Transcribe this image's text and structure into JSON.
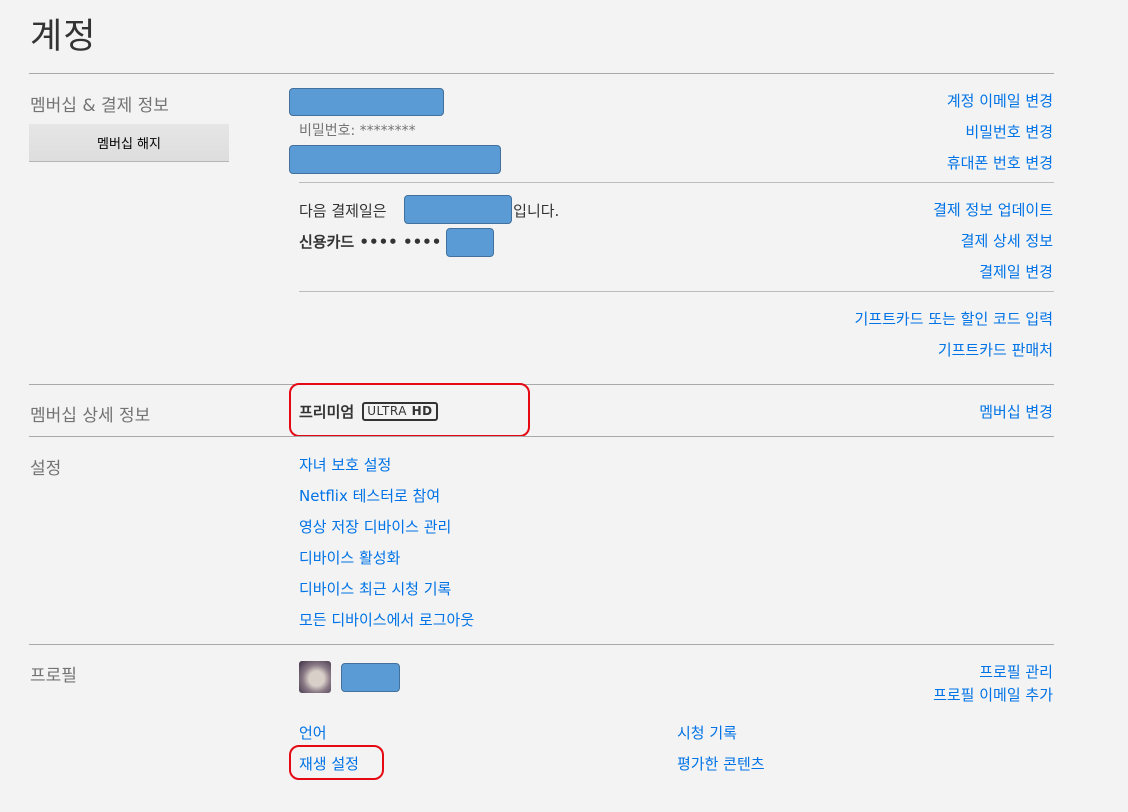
{
  "page": {
    "title": "계정"
  },
  "membership_billing": {
    "section_title": "멤버십 & 결제 정보",
    "cancel_button": "멤버십 해지",
    "password_text": "비밀번호: ********",
    "links": {
      "change_email": "계정 이메일 변경",
      "change_password": "비밀번호 변경",
      "change_phone": "휴대폰 번호 변경"
    },
    "next_billing_prefix": "다음 결제일은 ",
    "next_billing_suffix": "일입니다.",
    "credit_card_text": "신용카드 •••• •••• ••••",
    "billing_links": {
      "update_payment": "결제 정보 업데이트",
      "billing_details": "결제 상세 정보",
      "change_billing_day": "결제일 변경"
    },
    "gift_links": {
      "redeem": "기프트카드 또는 할인 코드 입력",
      "where_to_buy": "기프트카드 판매처"
    }
  },
  "plan_details": {
    "section_title": "멤버십 상세 정보",
    "plan_name": "프리미엄",
    "badge_ultra": "ULTRA",
    "badge_hd": "HD",
    "change_plan": "멤버십 변경"
  },
  "settings": {
    "section_title": "설정",
    "items": [
      "자녀 보호 설정",
      "Netflix 테스터로 참여",
      "영상 저장 디바이스 관리",
      "디바이스 활성화",
      "디바이스 최근 시청 기록",
      "모든 디바이스에서 로그아웃"
    ]
  },
  "profile": {
    "section_title": "프로필",
    "manage_profiles": "프로필 관리",
    "add_profile_email": "프로필 이메일 추가",
    "language": "언어",
    "playback_settings": "재생 설정",
    "viewing_activity": "시청 기록",
    "ratings": "평가한 콘텐츠"
  },
  "colors": {
    "link": "#0073e6",
    "highlight": "#e50914",
    "redaction": "#5b9bd5"
  }
}
